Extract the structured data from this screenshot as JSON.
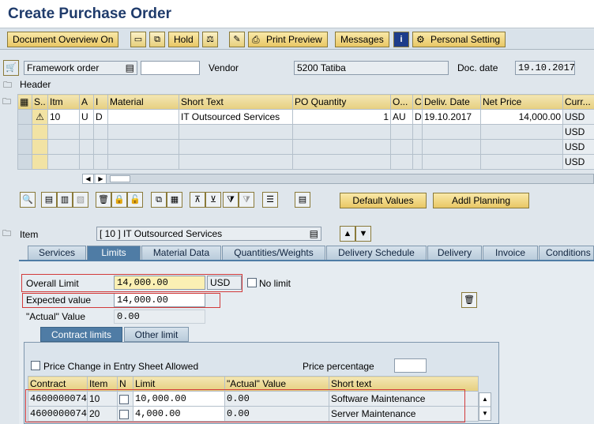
{
  "title": "Create Purchase Order",
  "toolbar": {
    "doc_overview": "Document Overview On",
    "hold": "Hold",
    "print_preview": "Print Preview",
    "messages": "Messages",
    "personal_setting": "Personal Setting"
  },
  "header_row": {
    "order_type": "Framework order",
    "vendor_label": "Vendor",
    "vendor_value": "5200 Tatiba",
    "doc_date_label": "Doc. date",
    "doc_date_value": "19.10.2017",
    "header_label": "Header"
  },
  "items_table": {
    "columns": [
      "S..",
      "Itm",
      "A",
      "I",
      "Material",
      "Short Text",
      "PO Quantity",
      "O...",
      "C",
      "Deliv. Date",
      "Net Price",
      "Curr..."
    ],
    "rows": [
      {
        "itm": "10",
        "a": "U",
        "i": "D",
        "material": "",
        "short_text": "IT Outsourced Services",
        "qty": "1",
        "o": "AU",
        "c": "D",
        "deliv": "19.10.2017",
        "price": "14,000.00",
        "curr": "USD"
      },
      {
        "curr": "USD"
      },
      {
        "curr": "USD"
      },
      {
        "curr": "USD"
      }
    ]
  },
  "actions": {
    "default_values": "Default Values",
    "addl_planning": "Addl Planning"
  },
  "item_row": {
    "label": "Item",
    "value": "[ 10 ] IT Outsourced Services"
  },
  "tabs": [
    "Services",
    "Limits",
    "Material Data",
    "Quantities/Weights",
    "Delivery Schedule",
    "Delivery",
    "Invoice",
    "Conditions"
  ],
  "limits": {
    "overall_limit_label": "Overall Limit",
    "overall_limit_value": "14,000.00",
    "currency": "USD",
    "no_limit_label": "No limit",
    "expected_label": "Expected value",
    "expected_value": "14,000.00",
    "actual_label": "\"Actual\" Value",
    "actual_value": "0.00"
  },
  "subtabs": [
    "Contract limits",
    "Other limit"
  ],
  "contract": {
    "price_change_label": "Price Change in Entry Sheet Allowed",
    "price_pct_label": "Price percentage",
    "columns": [
      "Contract",
      "Item",
      "N",
      "Limit",
      "\"Actual\" Value",
      "Short text"
    ],
    "rows": [
      {
        "contract": "4600000074",
        "item": "10",
        "limit": "10,000.00",
        "actual": "0.00",
        "short_text": "Software Maintenance"
      },
      {
        "contract": "4600000074",
        "item": "20",
        "limit": "4,000.00",
        "actual": "0.00",
        "short_text": "Server Maintenance"
      }
    ]
  },
  "colors": {
    "accent": "#4f7ca5",
    "title": "#1f3b6b",
    "highlight": "#d23a3a",
    "button": "#e9c765"
  }
}
